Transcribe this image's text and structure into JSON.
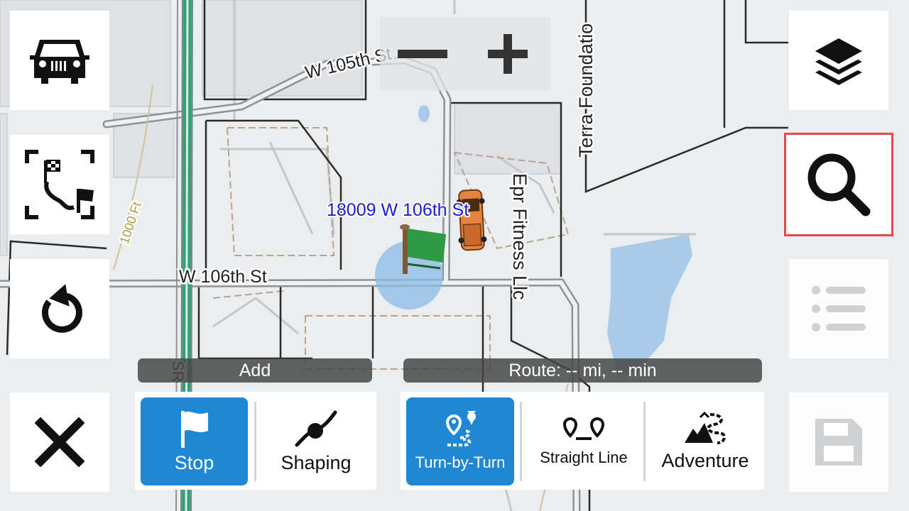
{
  "map": {
    "street_w105": "W 105th St",
    "street_w106": "W 106th St",
    "terra": "Terra Foundatio",
    "epr": "Epr Fitness Llc",
    "contour_1000": "1000 Ft",
    "sr": "SR",
    "address_label": "18009 W 106th St",
    "address_color": "#1a1ad6"
  },
  "left_buttons": [
    {
      "icon": "vehicle-icon"
    },
    {
      "icon": "route-overview-icon"
    },
    {
      "icon": "undo-icon"
    },
    {
      "icon": "close-icon"
    }
  ],
  "right_buttons": [
    {
      "icon": "layers-icon"
    },
    {
      "icon": "search-icon",
      "highlighted": true
    },
    {
      "icon": "list-icon",
      "disabled": true
    },
    {
      "icon": "save-icon",
      "disabled": true
    }
  ],
  "zoom": {
    "out_icon": "minus-icon",
    "in_icon": "plus-icon"
  },
  "add_panel": {
    "header": "Add",
    "options": [
      {
        "label": "Stop",
        "icon": "flag-icon",
        "active": true
      },
      {
        "label": "Shaping",
        "icon": "shaping-icon",
        "active": false
      }
    ]
  },
  "route_panel": {
    "header": "Route: -- mi, -- min",
    "options": [
      {
        "label": "Turn-by-Turn",
        "icon": "turn-by-turn-icon",
        "active": true
      },
      {
        "label": "Straight Line",
        "icon": "straight-line-icon",
        "active": false
      },
      {
        "label": "Adventure",
        "icon": "adventure-icon",
        "active": false
      }
    ]
  },
  "colors": {
    "accent": "#1e88d5",
    "highlight": "#e8474f",
    "water": "#a9cbe9",
    "flag": "#2e9a46"
  }
}
